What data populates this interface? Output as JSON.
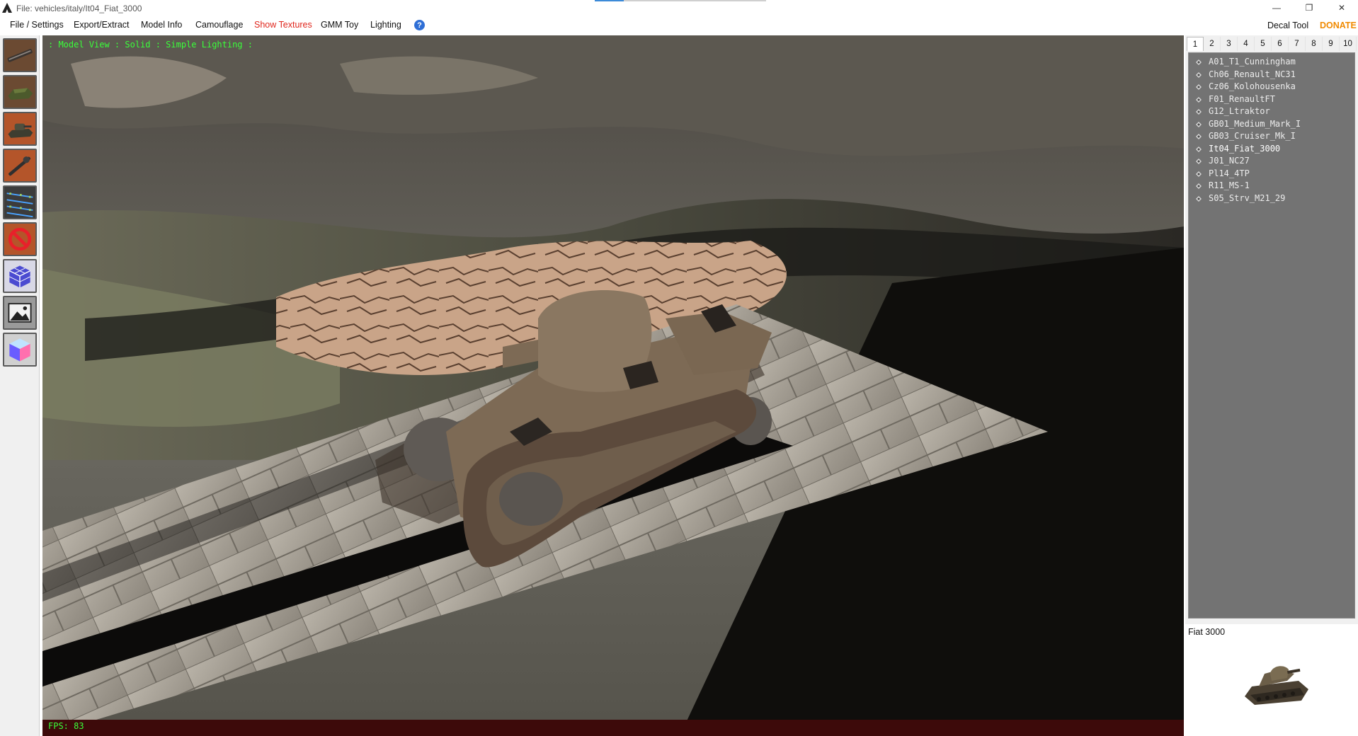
{
  "window": {
    "title": "File: vehicles/italy/It04_Fiat_3000",
    "progress": 0.17,
    "min_glyph": "—",
    "restore_glyph": "❐",
    "close_glyph": "✕"
  },
  "menu": {
    "items": [
      {
        "label": "File / Settings",
        "active": false
      },
      {
        "label": "Export/Extract",
        "active": false
      },
      {
        "label": "Model Info",
        "active": false
      },
      {
        "label": "Camouflage",
        "active": false
      },
      {
        "label": "Show Textures",
        "active": true
      },
      {
        "label": "GMM Toy",
        "active": false
      },
      {
        "label": "Lighting",
        "active": false
      }
    ],
    "help_icon": "?",
    "decal_tool": "Decal Tool",
    "donate": "DONATE"
  },
  "toolbar": {
    "buttons": [
      {
        "name": "gun-tool-icon"
      },
      {
        "name": "hull-tool-icon"
      },
      {
        "name": "tank-model-tool-icon"
      },
      {
        "name": "barrel-tool-icon"
      },
      {
        "name": "track-points-tool-icon"
      },
      {
        "name": "no-entry-tool-icon"
      },
      {
        "name": "cube-grid-tool-icon"
      },
      {
        "name": "image-tool-icon"
      },
      {
        "name": "color-cube-tool-icon"
      }
    ]
  },
  "viewport": {
    "status": ": Model View : Solid : Simple Lighting :",
    "fps": "FPS: 83"
  },
  "tabs": [
    "1",
    "2",
    "3",
    "4",
    "5",
    "6",
    "7",
    "8",
    "9",
    "10"
  ],
  "selected_tab": "1",
  "tank_list": [
    "A01_T1_Cunningham",
    "Ch06_Renault_NC31",
    "Cz06_Kolohousenka",
    "F01_RenaultFT",
    "G12_Ltraktor",
    "GB01_Medium_Mark_I",
    "GB03_Cruiser_Mk_I",
    "It04_Fiat_3000",
    "J01_NC27",
    "Pl14_4TP",
    "R11_MS-1",
    "S05_Strv_M21_29"
  ],
  "selected_tank": "It04_Fiat_3000",
  "preview": {
    "title": "Fiat 3000"
  },
  "colors": {
    "accent_red": "#e0261c",
    "donate_orange": "#f08a00",
    "status_green": "#3aff3a",
    "tank_list_bg": "#737373"
  }
}
